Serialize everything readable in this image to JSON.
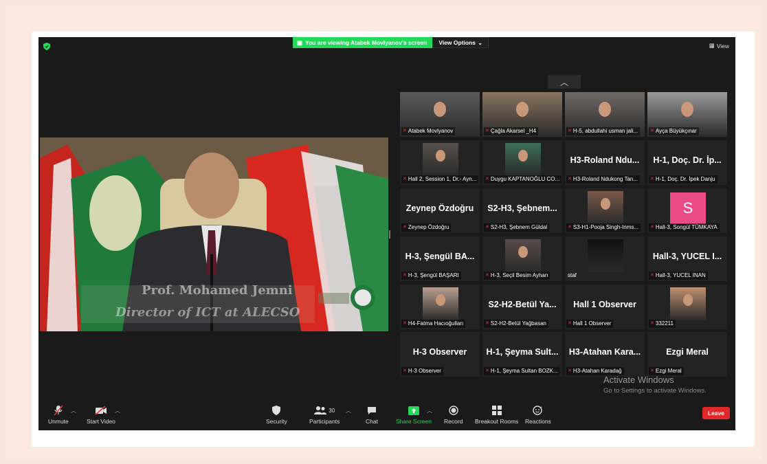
{
  "banner": {
    "viewing": "You are viewing Atabek Movlyanov's screen",
    "options": "View Options"
  },
  "view_button": "View",
  "main_video": {
    "caption_name": "Prof. Mohamed Jemni",
    "caption_title": "Director of ICT at ALECSO"
  },
  "tiles": [
    {
      "label": "Atabek Movlyanov",
      "type": "video"
    },
    {
      "label": "Çağla Akarsel _H4",
      "type": "video",
      "active": true
    },
    {
      "label": "H-5, abdullahi usman jali...",
      "type": "video"
    },
    {
      "label": "Ayça Büyükçınar",
      "type": "video"
    },
    {
      "label": "Hall 2, Session 1, Dr.- Ayn...",
      "type": "video"
    },
    {
      "label": "Duygu KAPTANOĞLU CO...",
      "type": "video"
    },
    {
      "label": "H3-Roland Ndukong Tan...",
      "name": "H3-Roland Ndu...",
      "type": "name"
    },
    {
      "label": "H-1, Doç. Dr. İpek Danju",
      "name": "H-1, Doç. Dr. İp...",
      "type": "name"
    },
    {
      "label": "Zeynep Özdoğru",
      "name": "Zeynep Özdoğru",
      "type": "name"
    },
    {
      "label": "S2-H3,  Şebnem Güldal",
      "name": "S2-H3,  Şebnem...",
      "type": "name"
    },
    {
      "label": "S3-H1-Pooja Singh-Inms...",
      "type": "video"
    },
    {
      "label": "Hall-3, Songül TÜMKAYA",
      "avatar": "S",
      "type": "avatar"
    },
    {
      "label": "H-3, Şengül BAŞARI",
      "name": "H-3, Şengül BA...",
      "type": "name"
    },
    {
      "label": "H-3, Seçil Besim Ayhan",
      "type": "video"
    },
    {
      "label": "staf",
      "type": "video",
      "nomic": true
    },
    {
      "label": "Hall-3, YUCEL INAN",
      "name": "Hall-3, YUCEL I...",
      "type": "name"
    },
    {
      "label": "H4-Fatma Hacıoğulları",
      "type": "video"
    },
    {
      "label": "S2-H2-Betül Yağbasan",
      "name": "S2-H2-Betül Ya...",
      "type": "name"
    },
    {
      "label": "Hall 1 Observer",
      "name": "Hall 1 Observer",
      "type": "name"
    },
    {
      "label": "332211",
      "type": "video"
    },
    {
      "label": "H-3 Observer",
      "name": "H-3 Observer",
      "type": "name"
    },
    {
      "label": "H-1, Şeyma Sultan BOZK...",
      "name": "H-1, Şeyma Sult...",
      "type": "name"
    },
    {
      "label": "H3-Atahan Karadağ",
      "name": "H3-Atahan  Kara...",
      "type": "name"
    },
    {
      "label": "Ezgi Meral",
      "name": "Ezgi Meral",
      "type": "name"
    }
  ],
  "watermark": {
    "line1": "Activate Windows",
    "line2": "Go to Settings to activate Windows."
  },
  "toolbar": {
    "unmute": "Unmute",
    "start_video": "Start Video",
    "security": "Security",
    "participants": "Participants",
    "participants_count": "30",
    "chat": "Chat",
    "share_screen": "Share Screen",
    "record": "Record",
    "breakout": "Breakout Rooms",
    "reactions": "Reactions",
    "leave": "Leave"
  },
  "colors": {
    "accent_green": "#23d959",
    "leave_red": "#e02828",
    "active_border": "#d6e06a",
    "avatar_pink": "#ea4c89"
  }
}
